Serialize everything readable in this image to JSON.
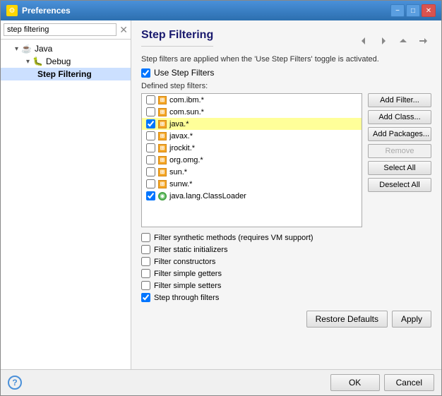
{
  "window": {
    "title": "Preferences",
    "minimize_label": "−",
    "maximize_label": "□",
    "close_label": "✕"
  },
  "sidebar": {
    "search_placeholder": "step filtering",
    "items": [
      {
        "label": "Java",
        "level": 1,
        "type": "parent",
        "expanded": true
      },
      {
        "label": "Debug",
        "level": 2,
        "type": "parent",
        "expanded": true
      },
      {
        "label": "Step Filtering",
        "level": 3,
        "type": "leaf",
        "selected": true
      }
    ]
  },
  "main": {
    "title": "Step Filtering",
    "description": "Step filters are applied when the 'Use Step Filters' toggle is activated.",
    "use_filters_label": "Use Step Filters",
    "defined_label": "Defined step filters:",
    "filters": [
      {
        "checked": false,
        "type": "pkg",
        "label": "com.ibm.*",
        "highlighted": false
      },
      {
        "checked": false,
        "type": "pkg",
        "label": "com.sun.*",
        "highlighted": false
      },
      {
        "checked": true,
        "type": "pkg",
        "label": "java.*",
        "highlighted": true
      },
      {
        "checked": false,
        "type": "pkg",
        "label": "javax.*",
        "highlighted": false
      },
      {
        "checked": false,
        "type": "pkg",
        "label": "jrockit.*",
        "highlighted": false
      },
      {
        "checked": false,
        "type": "pkg",
        "label": "org.omg.*",
        "highlighted": false
      },
      {
        "checked": false,
        "type": "pkg",
        "label": "sun.*",
        "highlighted": false
      },
      {
        "checked": false,
        "type": "pkg",
        "label": "sunw.*",
        "highlighted": false
      },
      {
        "checked": true,
        "type": "cls",
        "label": "java.lang.ClassLoader",
        "highlighted": false
      }
    ],
    "buttons": {
      "add_filter": "Add Filter...",
      "add_class": "Add Class...",
      "add_packages": "Add Packages...",
      "remove": "Remove",
      "select_all": "Select All",
      "deselect_all": "Deselect All"
    },
    "options": [
      {
        "checked": false,
        "label": "Filter synthetic methods (requires VM support)"
      },
      {
        "checked": false,
        "label": "Filter static initializers"
      },
      {
        "checked": false,
        "label": "Filter constructors"
      },
      {
        "checked": false,
        "label": "Filter simple getters"
      },
      {
        "checked": false,
        "label": "Filter simple setters"
      },
      {
        "checked": true,
        "label": "Step through filters"
      }
    ],
    "restore_defaults": "Restore Defaults",
    "apply": "Apply"
  },
  "footer": {
    "ok": "OK",
    "cancel": "Cancel",
    "help_icon": "?"
  }
}
